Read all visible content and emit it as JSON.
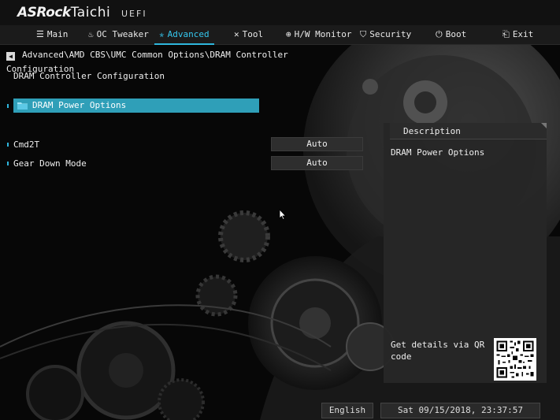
{
  "brand": {
    "name_bold": "ASRock",
    "name_light": "Taichi",
    "tag": "UEFI"
  },
  "nav": [
    {
      "id": "main",
      "label": "Main",
      "icon": "list-icon"
    },
    {
      "id": "oc",
      "label": "OC Tweaker",
      "icon": "flame-icon"
    },
    {
      "id": "advanced",
      "label": "Advanced",
      "icon": "star-icon",
      "active": true
    },
    {
      "id": "tool",
      "label": "Tool",
      "icon": "tools-icon"
    },
    {
      "id": "hw",
      "label": "H/W Monitor",
      "icon": "monitor-icon"
    },
    {
      "id": "security",
      "label": "Security",
      "icon": "shield-icon"
    },
    {
      "id": "boot",
      "label": "Boot",
      "icon": "power-icon"
    },
    {
      "id": "exit",
      "label": "Exit",
      "icon": "exit-icon"
    }
  ],
  "breadcrumb": "Advanced\\AMD CBS\\UMC Common Options\\DRAM Controller Configuration",
  "page_title": "DRAM Controller Configuration",
  "submenu": {
    "label": "DRAM Power Options"
  },
  "settings": [
    {
      "label": "Cmd2T",
      "value": "Auto"
    },
    {
      "label": "Gear Down Mode",
      "value": "Auto"
    }
  ],
  "description": {
    "header": "Description",
    "text": "DRAM Power Options",
    "qr_text": "Get details via QR code"
  },
  "footer": {
    "language": "English",
    "datetime": "Sat 09/15/2018, 23:37:57"
  },
  "colors": {
    "accent": "#2fb6dd",
    "selected_row": "#2f9fb8",
    "active_tab_text": "#35c8f0"
  }
}
